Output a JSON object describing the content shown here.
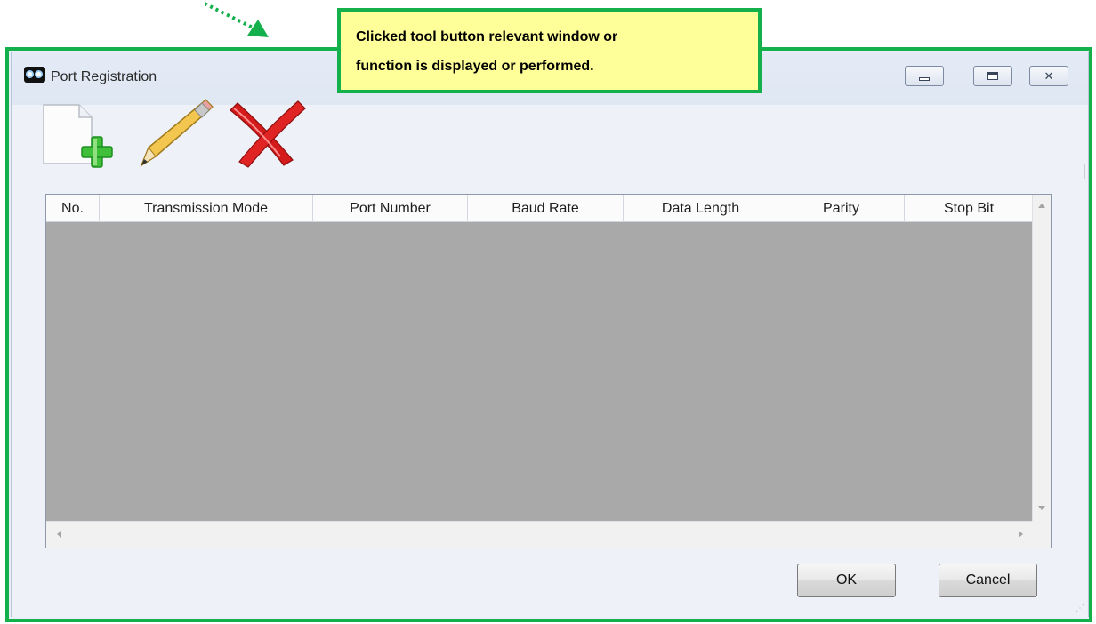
{
  "window": {
    "title": "Port Registration",
    "controls": {
      "minimize": "minimize",
      "maximize": "maximize",
      "close": "close"
    }
  },
  "toolbar": {
    "items": [
      {
        "name": "new",
        "icon": "new-document-plus-icon"
      },
      {
        "name": "edit",
        "icon": "pencil-icon"
      },
      {
        "name": "delete",
        "icon": "red-x-icon"
      }
    ]
  },
  "grid": {
    "columns": [
      "No.",
      "Transmission Mode",
      "Port Number",
      "Baud Rate",
      "Data Length",
      "Parity",
      "Stop Bit"
    ],
    "rows": []
  },
  "buttons": {
    "ok": "OK",
    "cancel": "Cancel"
  },
  "annotation": {
    "line1": "Clicked tool button relevant window or",
    "line2": "function is displayed or performed."
  },
  "colors": {
    "annotation_border": "#14b04c",
    "annotation_fill": "#ffff99",
    "grid_empty": "#a9a9a9"
  }
}
